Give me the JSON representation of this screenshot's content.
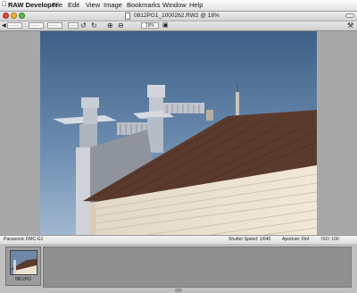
{
  "menubar": {
    "app_name": "RAW Developer",
    "items": [
      "File",
      "Edit",
      "View",
      "Image",
      "Bookmarks",
      "Window",
      "Help"
    ]
  },
  "window": {
    "title": "0812PG1_1000262.RW2 @ 18%",
    "traffic_lights": {
      "close": "#e64a3c",
      "minimize": "#f2b233",
      "zoom": "#5bbf3b"
    }
  },
  "toolbar": {
    "field_1": "-------",
    "field_2": "------",
    "field_3": "------",
    "field_4": "------",
    "zoom_value": "18%",
    "icons": [
      "rotate-left-icon",
      "rotate-right-icon",
      "zoom-in-icon",
      "zoom-out-icon",
      "fit-window-icon"
    ]
  },
  "status": {
    "camera": "Panasonic DMC-G1",
    "shutter": "Shutter Speed: 1/640",
    "aperture": "Aperture: f/inf",
    "iso": "ISO: 100"
  },
  "filmstrip": {
    "thumb_label": "0812PG"
  }
}
